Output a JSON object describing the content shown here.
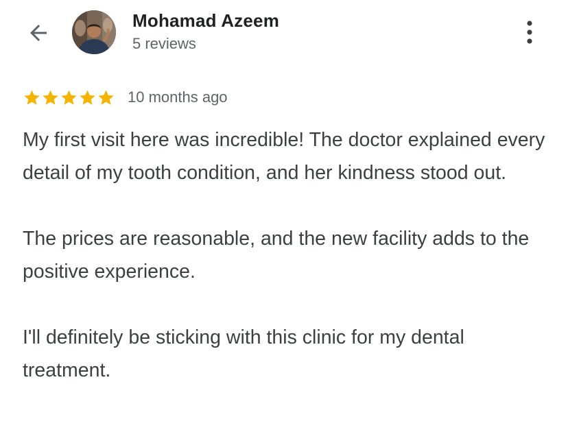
{
  "header": {
    "back_icon": "arrow-left-icon",
    "author_name": "Mohamad Azeem",
    "review_count": "5 reviews",
    "more_icon": "more-vertical-icon"
  },
  "rating": {
    "stars": 5,
    "max_stars": 5,
    "star_color": "#f4b400",
    "date": "10 months ago"
  },
  "review": {
    "paragraphs": [
      "My first visit here was incredible! The doctor explained every detail of my tooth condition, and her kindness stood out.",
      "The prices are reasonable, and the new facility adds to the positive experience.",
      "I'll definitely be sticking with this clinic for my dental treatment."
    ]
  },
  "colors": {
    "text_primary": "#202124",
    "text_body": "#3c4043",
    "text_secondary": "#5f6368",
    "icon": "#5f6368"
  }
}
